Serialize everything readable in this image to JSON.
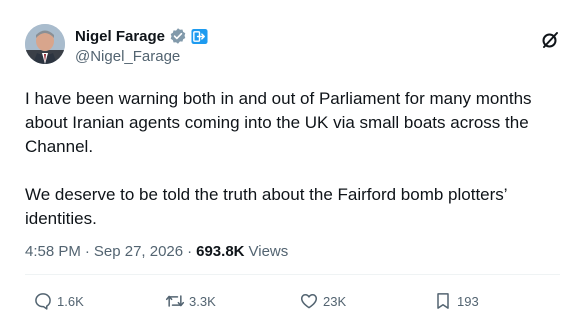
{
  "author": {
    "display_name": "Nigel Farage",
    "handle": "@Nigel_Farage",
    "verified_badge_color": "#829aab",
    "affiliate_badge_color": "#1d9bf0"
  },
  "icons": {
    "avatar": "avatar",
    "verified": "verified-badge-icon",
    "affiliate": "affiliate-badge-icon",
    "grok": "grok-icon",
    "reply": "reply-icon",
    "repost": "repost-icon",
    "like": "like-icon",
    "bookmark": "bookmark-icon"
  },
  "tweet": {
    "paragraphs": [
      "I have been warning both in and out of Parliament for many months about Iranian agents coming into the UK via small boats across the Channel.",
      "We deserve to be told the truth about the Fairford bomb plotters’ identities."
    ]
  },
  "meta": {
    "time": "4:58 PM",
    "separator": "·",
    "date": "Sep 27, 2026",
    "views_count": "693.8K",
    "views_label": "Views"
  },
  "actions": {
    "replies": "1.6K",
    "reposts": "3.3K",
    "likes": "23K",
    "bookmarks": "193"
  },
  "colors": {
    "text": "#0f1419",
    "secondary": "#536471",
    "divider": "#eff3f4"
  }
}
